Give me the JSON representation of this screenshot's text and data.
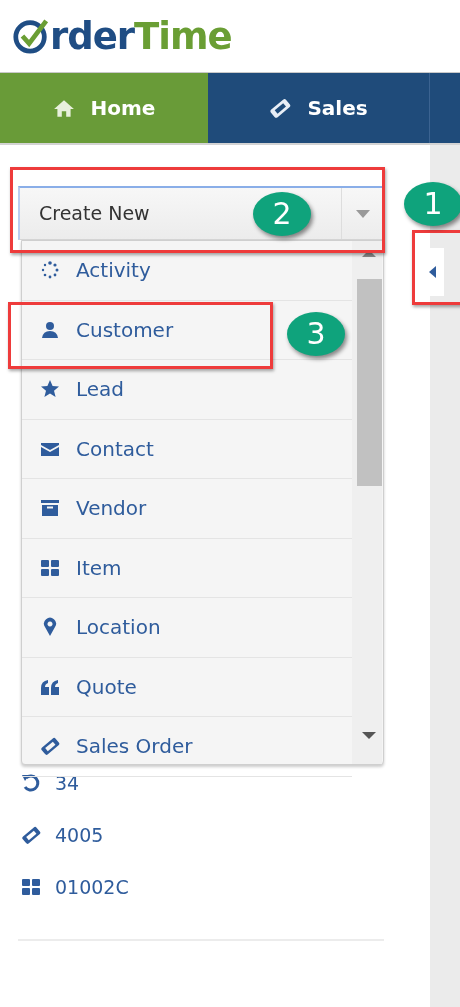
{
  "logo": {
    "part_1": "rder",
    "part_2": "Time"
  },
  "nav_tabs": [
    {
      "label": "Home",
      "selected": true
    },
    {
      "label": "Sales",
      "selected": false
    }
  ],
  "create_new": {
    "label": "Create New",
    "expanded": true
  },
  "create_menu": [
    {
      "label": "Activity"
    },
    {
      "label": "Customer"
    },
    {
      "label": "Lead"
    },
    {
      "label": "Contact"
    },
    {
      "label": "Vendor"
    },
    {
      "label": "Item"
    },
    {
      "label": "Location"
    },
    {
      "label": "Quote"
    },
    {
      "label": "Sales Order"
    }
  ],
  "recent_items": [
    {
      "text": "34"
    },
    {
      "text": "4005"
    },
    {
      "text": "01002C"
    }
  ],
  "annotations": [
    {
      "label": "1"
    },
    {
      "label": "2"
    },
    {
      "label": "3"
    }
  ]
}
